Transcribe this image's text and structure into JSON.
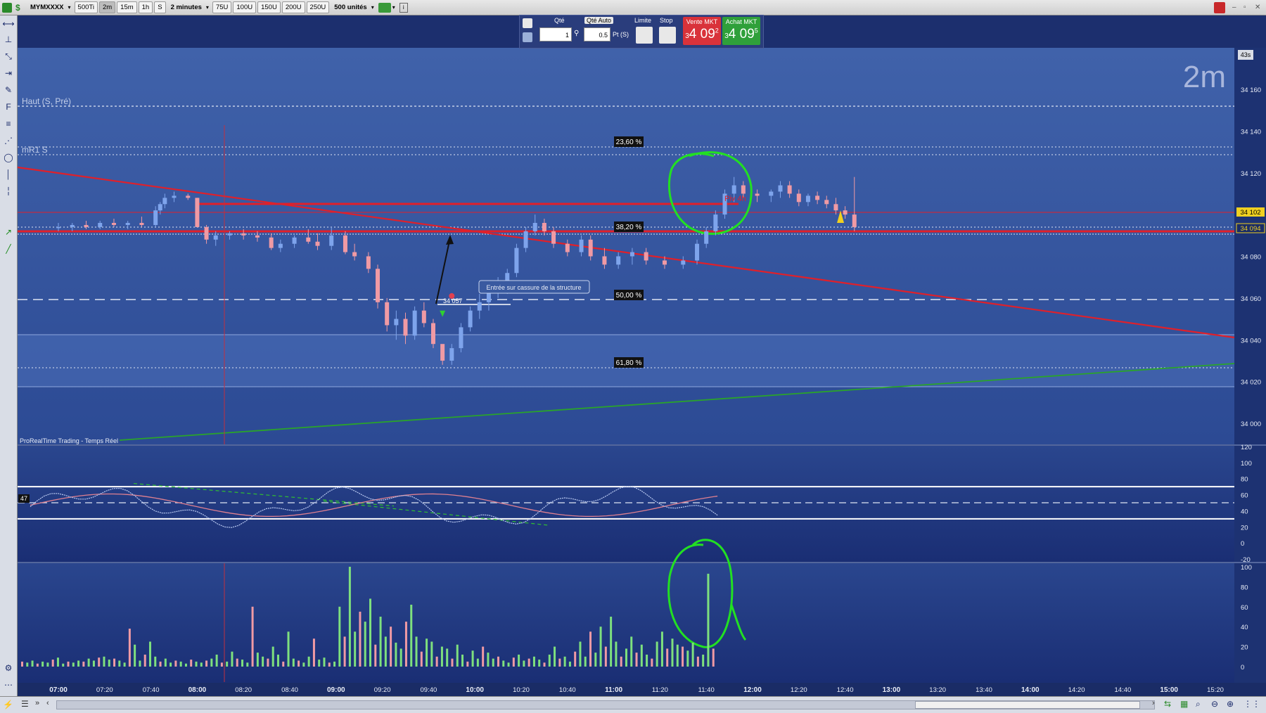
{
  "toolbar": {
    "symbol": "MYMXXXX",
    "ticks": "500Ti",
    "tf_2m": "2m",
    "tf_15m": "15m",
    "tf_1h": "1h",
    "tf_s": "S",
    "timeframe": "2 minutes",
    "u75": "75U",
    "u100": "100U",
    "u150": "150U",
    "u200": "200U",
    "u250": "250U",
    "units": "500 unités"
  },
  "order_panel": {
    "qty_label": "Qté",
    "qty_value": "1",
    "qty_auto_label": "Qté Auto",
    "qty_auto_value": "0.5",
    "pts_label": "Pt (S)",
    "limit_label": "Limite",
    "stop_label": "Stop",
    "sell_label": "Vente MKT",
    "sell_price_small": "3",
    "sell_price": "4 09",
    "sell_price_sup": "2",
    "buy_label": "Achat MKT",
    "buy_price_small": "3",
    "buy_price": "4 09",
    "buy_price_sup": "5"
  },
  "chart": {
    "timeframe_watermark": "2m",
    "timer": "43s",
    "source_label": "ProRealTime Trading - Temps Réel",
    "label_haut": "Haut (S, Pré)",
    "label_mr1": "mR1 S",
    "label_piv": "Piv 4h",
    "annotation": "Entrée sur cassure de la structure",
    "entry_price": "34 057",
    "current_price_1": "34 102",
    "current_price_2": "34 094",
    "fib_levels": [
      "23,60 %",
      "38,20 %",
      "50,00 %",
      "61,80 %"
    ],
    "price_ticks": [
      "34 160",
      "34 140",
      "34 120",
      "34 080",
      "34 060",
      "34 040",
      "34 020",
      "34 000"
    ],
    "time_ticks": [
      "07:00",
      "07:20",
      "07:40",
      "08:00",
      "08:20",
      "08:40",
      "09:00",
      "09:20",
      "09:40",
      "10:00",
      "10:20",
      "10:40",
      "11:00",
      "11:20",
      "11:40",
      "12:00",
      "12:20",
      "12:40",
      "13:00",
      "13:20",
      "13:40",
      "14:00",
      "14:20",
      "14:40",
      "15:00",
      "15:20"
    ],
    "colors": {
      "background": "#3f5fa8",
      "candle_up": "#7ea4ec",
      "candle_down": "#f09aa4",
      "resistance_line": "#e0202a",
      "support_line": "#2aa42a",
      "markup": "#22e022"
    }
  },
  "oscillator": {
    "value_label": "47",
    "ticks": [
      "120",
      "100",
      "80",
      "60",
      "40",
      "20",
      "0",
      "-20"
    ]
  },
  "volume": {
    "ticks": [
      "100",
      "80",
      "60",
      "40",
      "20",
      "0"
    ]
  }
}
